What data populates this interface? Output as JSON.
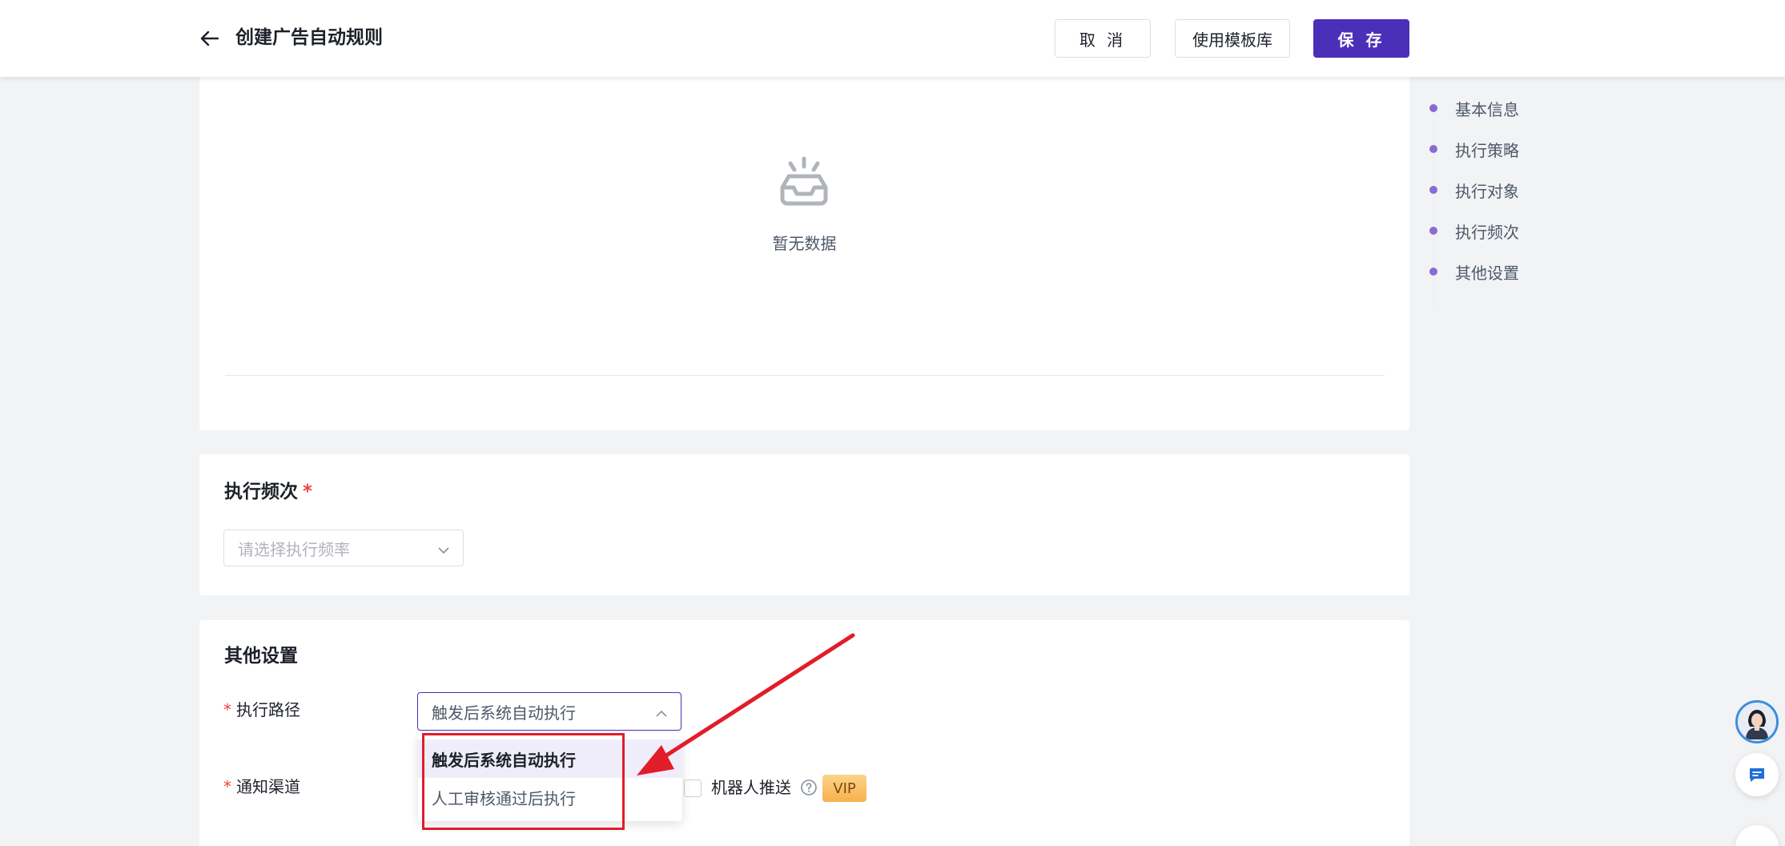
{
  "header": {
    "title": "创建广告自动规则",
    "cancel_label": "取 消",
    "template_label": "使用模板库",
    "save_label": "保 存"
  },
  "empty_state": {
    "text": "暂无数据",
    "icon": "inbox-empty-icon"
  },
  "frequency": {
    "title": "执行频次",
    "required_mark": "*",
    "placeholder": "请选择执行频率"
  },
  "other_settings": {
    "title": "其他设置",
    "path_label": "执行路径",
    "path_value": "触发后系统自动执行",
    "required_mark": "*",
    "notify_label": "通知渠道",
    "robot_label": "机器人推送",
    "vip_label": "VIP",
    "dropdown_options": [
      {
        "label": "触发后系统自动执行",
        "selected": true
      },
      {
        "label": "人工审核通过后执行",
        "selected": false
      }
    ]
  },
  "anchor_nav": {
    "items": [
      "基本信息",
      "执行策略",
      "执行对象",
      "执行频次",
      "其他设置"
    ]
  },
  "colors": {
    "primary": "#4a2fb8",
    "annotation_red": "#e11d2a",
    "anchor_dot": "#8a6bd6",
    "vip": "#f7b04c"
  }
}
